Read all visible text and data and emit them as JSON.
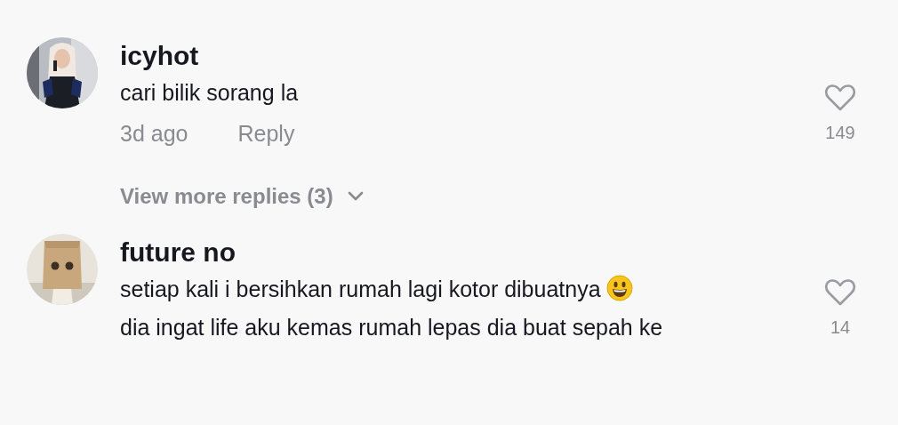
{
  "comments": [
    {
      "username": "icyhot",
      "avatar": {
        "kind": "picture"
      },
      "body": [
        {
          "kind": "text",
          "text": "cari bilik sorang la"
        }
      ],
      "time": "3d ago",
      "reply": "Reply",
      "liked": false,
      "likes": "149",
      "more_replies": "View more replies (3)"
    },
    {
      "username": "future no",
      "avatar": {
        "kind": "picture"
      },
      "body": [
        {
          "kind": "text",
          "text": "setiap kali i bersihkan rumah lagi kotor dibuatnya"
        },
        {
          "kind": "emoji"
        },
        {
          "kind": "text",
          "text": "dia ingat life aku kemas rumah lepas dia buat sepah ke"
        }
      ],
      "liked": false,
      "likes": "14"
    }
  ]
}
